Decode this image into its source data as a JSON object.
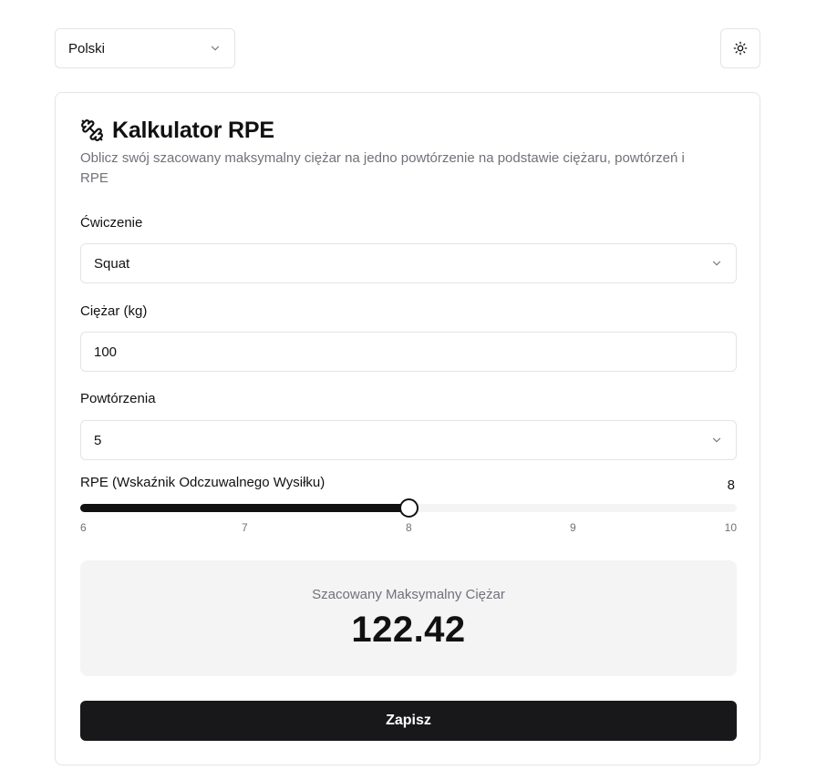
{
  "language_selector": {
    "value": "Polski",
    "icon": "chevron-down-icon"
  },
  "theme_toggle": {
    "icon": "sun-icon"
  },
  "card": {
    "icon": "dumbbell-icon",
    "title": "Kalkulator RPE",
    "subtitle": "Oblicz swój szacowany maksymalny ciężar na jedno powtórzenie na podstawie ciężaru, powtórzeń i RPE"
  },
  "form": {
    "exercise": {
      "label": "Ćwiczenie",
      "value": "Squat"
    },
    "weight": {
      "label": "Ciężar (kg)",
      "value": "100"
    },
    "reps": {
      "label": "Powtórzenia",
      "value": "5"
    },
    "rpe": {
      "label": "RPE (Wskaźnik Odczuwalnego Wysiłku)",
      "value": "8",
      "min": 6,
      "max": 10,
      "current": 8,
      "ticks": [
        "6",
        "7",
        "8",
        "9",
        "10"
      ]
    }
  },
  "result": {
    "label": "Szacowany Maksymalny Ciężar",
    "value": "122.42"
  },
  "save_button": {
    "label": "Zapisz"
  },
  "colors": {
    "primary": "#18181b",
    "muted_text": "#71717a",
    "border": "#e4e4e7",
    "muted_bg": "#f4f4f5"
  }
}
